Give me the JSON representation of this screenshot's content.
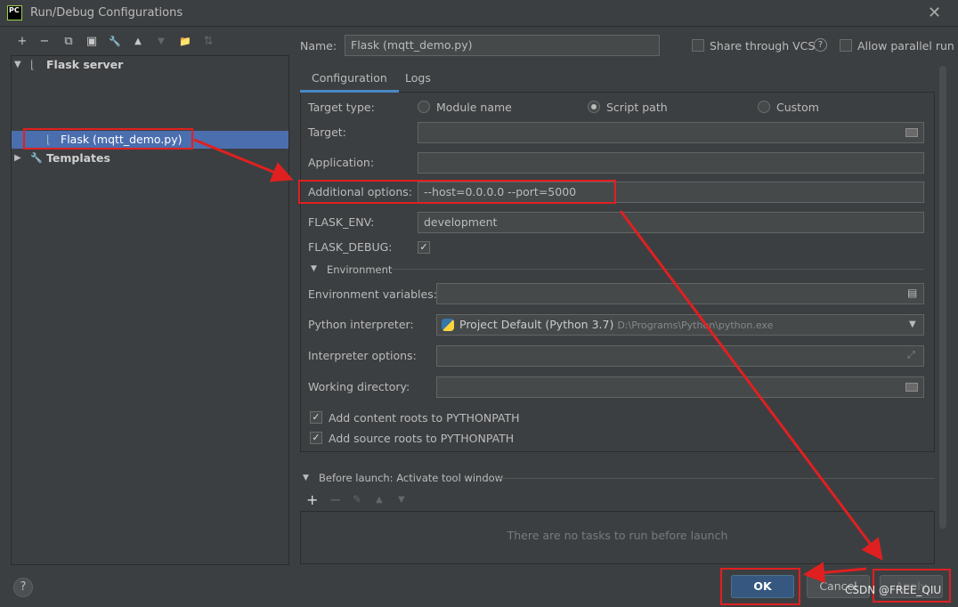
{
  "window": {
    "title": "Run/Debug Configurations",
    "app_icon_text": "PC",
    "close_glyph": "✕"
  },
  "toolbar": {
    "icons": [
      "add-icon",
      "remove-icon",
      "copy-icon",
      "save-icon",
      "wrench-icon",
      "move-up-icon",
      "move-down-icon",
      "new-folder-icon",
      "sort-icon"
    ],
    "glyphs": [
      "+",
      "−",
      "⧉",
      "▣",
      "🔧",
      "▲",
      "▼",
      "📁",
      "⇅"
    ]
  },
  "tree": {
    "group_label": "Flask server",
    "item_label": "Flask (mqtt_demo.py)",
    "templates_label": "Templates"
  },
  "header": {
    "name_label": "Name:",
    "name_value": "Flask (mqtt_demo.py)",
    "share_vcs_label": "Share through VCS",
    "parallel_label": "Allow parallel run"
  },
  "tabs": [
    "Configuration",
    "Logs"
  ],
  "config": {
    "target_type_label": "Target type:",
    "target_types": [
      "Module name",
      "Script path",
      "Custom"
    ],
    "target_label": "Target:",
    "target_value": "",
    "application_label": "Application:",
    "application_value": "",
    "additional_options_label": "Additional options:",
    "additional_options_value": "--host=0.0.0.0 --port=5000",
    "flask_env_label": "FLASK_ENV:",
    "flask_env_value": "development",
    "flask_debug_label": "FLASK_DEBUG:",
    "environment_label": "Environment",
    "env_vars_label": "Environment variables:",
    "python_interpreter_label": "Python interpreter:",
    "interpreter_name": "Project Default (Python 3.7)",
    "interpreter_path": "D:\\Programs\\Python\\python.exe",
    "interpreter_options_label": "Interpreter options:",
    "working_dir_label": "Working directory:",
    "add_content_roots_label": "Add content roots to PYTHONPATH",
    "add_source_roots_label": "Add source roots to PYTHONPATH"
  },
  "before_launch": {
    "title": "Before launch: Activate tool window",
    "empty_text": "There are no tasks to run before launch"
  },
  "buttons": {
    "ok": "OK",
    "cancel": "Cancel",
    "apply": "Apply"
  },
  "watermark": "CSDN @FREE_QIU",
  "accent_colors": {
    "selection": "#4b6eaf",
    "primary_button": "#365880",
    "annotation_red": "#e02020"
  }
}
